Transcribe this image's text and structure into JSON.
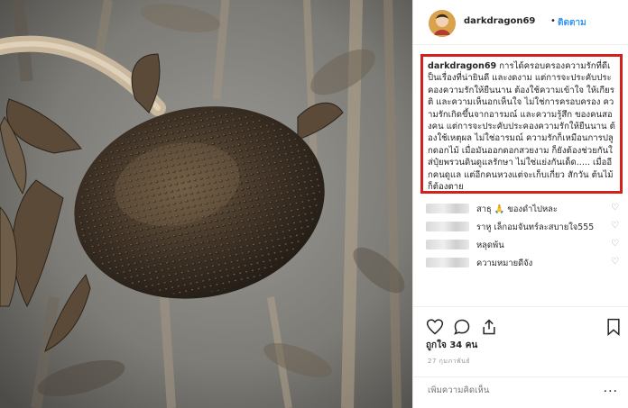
{
  "post": {
    "username": "darkdragon69",
    "dot": "•",
    "follow_label": "ติดตาม",
    "caption_username": "darkdragon69",
    "caption_text": "การได้ครอบครองความรักที่ดีเป็นเรื่องที่น่ายินดี และงดงาม แต่การจะประคับประคองความรักให้ยืนนาน ต้องใช้ความเข้าใจ ให้เกียรติ และความเห็นอกเห็นใจ ไม่ใช่การครอบครอง ความรักเกิดขึ้นจากอารมณ์ และความรู้สึก ของคนสองคน แต่การจะประคับประคองความรักให้ยืนนาน ต้องใช้เหตุผล ไม่ใช่อารมณ์ ความรักก็เหมือนการปลูกดอกไม้ เมื่อมันออกดอกสวยงาม ก็ยังต้องช่วยกันใส่ปุ๋ยพรวนดินดูแลรักษา ไม่ใช่แย่งกันเด็ด..... เมื่ออีกคนดูแล แต่อีกคนหวงแต่จะเก็บเกี่ยว สักวัน ต้นไม้ก็ต้องตาย"
  },
  "comments": [
    {
      "text": "สาธุ 🙏 ของดำไปหละ"
    },
    {
      "text": "ราหู เล็กอมจันทร์ละสบายใจ555"
    },
    {
      "text": "หลุดพ้น"
    },
    {
      "text": "ความหมายดีจัง"
    }
  ],
  "icons": {
    "heart": "heart-icon",
    "comment": "comment-icon",
    "share": "share-icon",
    "bookmark": "bookmark-icon",
    "more": "more-icon"
  },
  "likes_label": "ถูกใจ 34 คน",
  "date_label": "27 กุมภาพันธ์",
  "comment_input": {
    "placeholder": "เพิ่มความคิดเห็น"
  },
  "more_label": "···",
  "heart_glyph": "♡",
  "colors": {
    "highlight_border": "#d0211c",
    "follow": "#3897f0",
    "text": "#262626",
    "muted": "#999999"
  }
}
